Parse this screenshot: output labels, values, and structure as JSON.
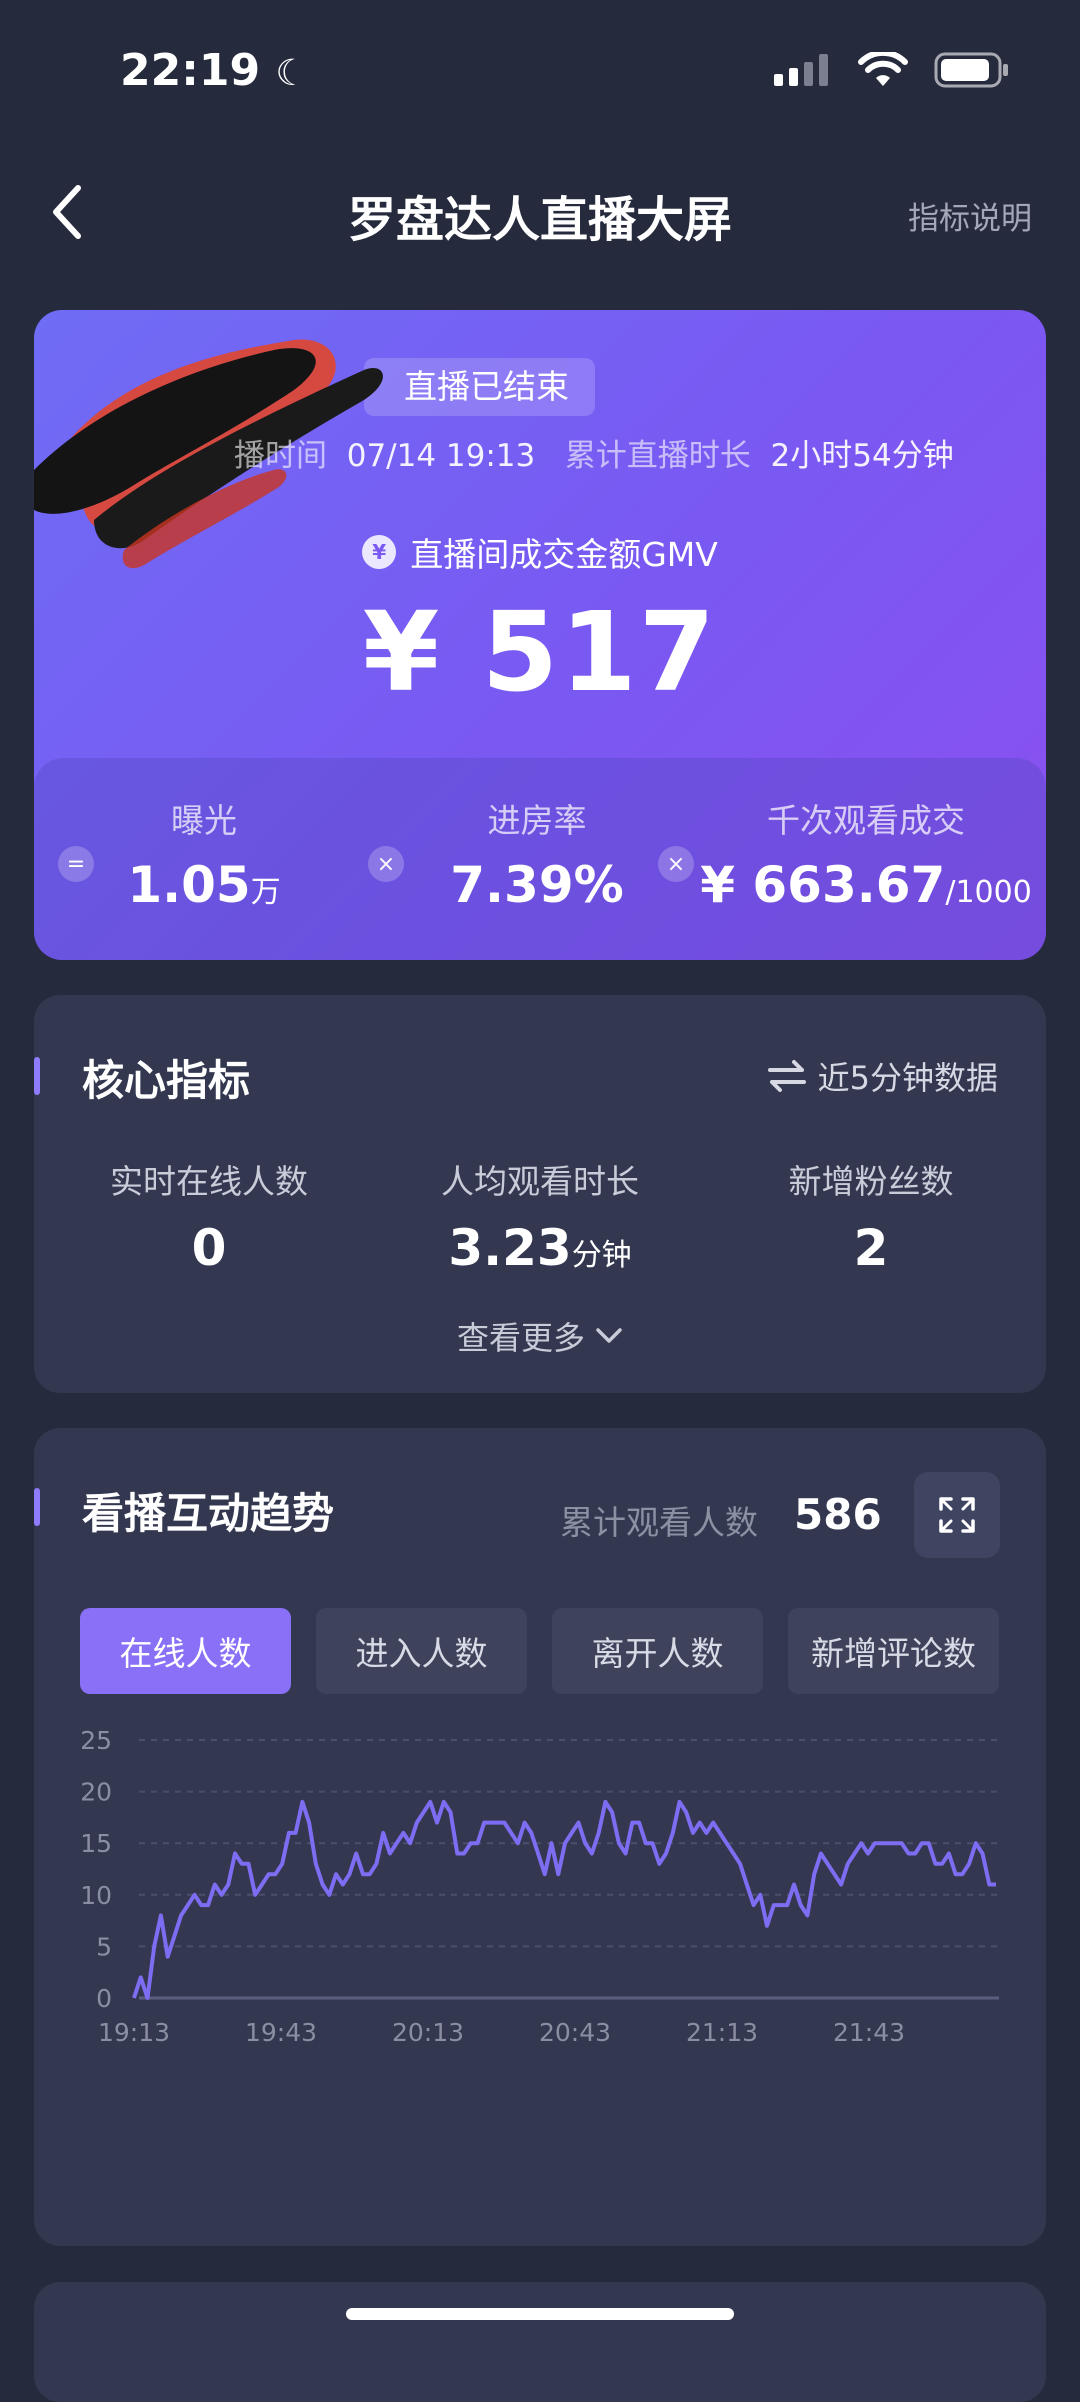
{
  "status_bar": {
    "time": "22:19"
  },
  "nav": {
    "title": "罗盘达人直播大屏",
    "help": "指标说明"
  },
  "gmv": {
    "badge": "直播已结束",
    "start_label": "播时间",
    "start_value": "07/14 19:13",
    "duration_label": "累计直播时长",
    "duration_value": "2小时54分钟",
    "label": "直播间成交金额GMV",
    "value": "¥ 517",
    "stats": [
      {
        "label": "曝光",
        "value": "1.05",
        "unit": "万",
        "op": "="
      },
      {
        "label": "进房率",
        "value": "7.39%",
        "unit": "",
        "op": "×"
      },
      {
        "label": "千次观看成交",
        "value": "¥ 663.67",
        "unit": "/1000",
        "op": "×"
      }
    ]
  },
  "core": {
    "title": "核心指标",
    "right": "近5分钟数据",
    "items": [
      {
        "label": "实时在线人数",
        "value": "0",
        "unit": ""
      },
      {
        "label": "人均观看时长",
        "value": "3.23",
        "unit": "分钟"
      },
      {
        "label": "新增粉丝数",
        "value": "2",
        "unit": ""
      }
    ],
    "more": "查看更多"
  },
  "trend": {
    "title": "看播互动趋势",
    "cum_label": "累计观看人数",
    "cum_value": "586",
    "tabs": [
      "在线人数",
      "进入人数",
      "离开人数",
      "新增评论数"
    ],
    "active_tab": 0
  },
  "colors": {
    "accent": "#8a6ff7",
    "line": "#7d6df2"
  },
  "chart_data": {
    "type": "line",
    "x_ticks": [
      "19:13",
      "19:43",
      "20:13",
      "20:43",
      "21:13",
      "21:43"
    ],
    "x_range_minutes": [
      0,
      174
    ],
    "ylim": [
      0,
      25
    ],
    "y_ticks": [
      0,
      5,
      10,
      15,
      20,
      25
    ],
    "grid": true,
    "series": [
      {
        "values": [
          0,
          2,
          0,
          5,
          8,
          4,
          6,
          8,
          9,
          10,
          9,
          9,
          11,
          10,
          11,
          14,
          13,
          13,
          10,
          11,
          12,
          12,
          13,
          16,
          16,
          19,
          17,
          13,
          11,
          10,
          12,
          11,
          12,
          14,
          12,
          12,
          13,
          16,
          14,
          15,
          16,
          15,
          17,
          18,
          19,
          17,
          19,
          18,
          14,
          14,
          15,
          15,
          17,
          17,
          17,
          17,
          16,
          15,
          17,
          16,
          14,
          12,
          15,
          12,
          15,
          16,
          17,
          15,
          14,
          16,
          19,
          18,
          15,
          14,
          17,
          17,
          15,
          15,
          13,
          14,
          16,
          19,
          18,
          16,
          17,
          16,
          17,
          16,
          15,
          14,
          13,
          11,
          9,
          10,
          7,
          9,
          9,
          9,
          11,
          9,
          8,
          12,
          14,
          13,
          12,
          11,
          13,
          14,
          15,
          14,
          15,
          15,
          15,
          15,
          15,
          14,
          14,
          15,
          15,
          13,
          13,
          14,
          12,
          12,
          13,
          15,
          14,
          11,
          11
        ]
      }
    ]
  }
}
